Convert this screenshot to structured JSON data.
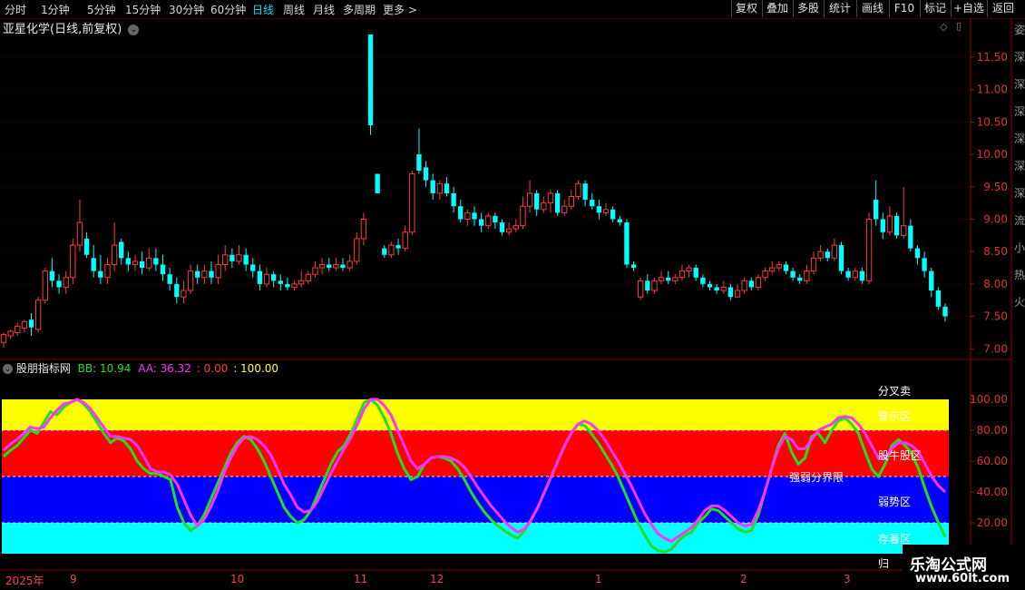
{
  "toolbar": {
    "periods": [
      "分时",
      "1分钟",
      "5分钟",
      "15分钟",
      "30分钟",
      "60分钟",
      "日线",
      "周线",
      "月线",
      "多周期",
      "更多 >"
    ],
    "active_period": "日线",
    "buttons": [
      "复权",
      "叠加",
      "多股",
      "统计",
      "画线",
      "F10",
      "标记",
      "+自选",
      "返回"
    ]
  },
  "main_panel": {
    "stock_title": "亚星化学(日线,前复权)",
    "price_ticks": [
      "11.50",
      "11.00",
      "10.50",
      "10.00",
      "9.50",
      "9.00",
      "8.50",
      "8.00",
      "7.50",
      "7.00"
    ],
    "price_range": [
      6.85,
      11.85
    ],
    "colors": {
      "up": "#ff3b3b",
      "down": "#00ffff"
    }
  },
  "indicator_panel": {
    "name": "股朋指标网",
    "bb_label": "BB: 10.94",
    "aa_label": "AA: 36.32",
    "zero_label": ": 0.00",
    "hundred_label": ": 100.00",
    "ticks": [
      "100.00",
      "80.00",
      "60.00",
      "40.00",
      "20.00"
    ],
    "zones": {
      "sell": "分叉卖",
      "alert": "警示区",
      "bull": "股牛股区",
      "divider": "强弱分界限",
      "weak": "弱势区",
      "store": "存着区",
      "bottom": "归"
    },
    "zone_colors": {
      "yellow": "#ffff00",
      "red": "#ff0000",
      "blue": "#0000ff",
      "cyan": "#00ffff"
    },
    "series_colors": {
      "BB": "#22dd22",
      "AA": "#ff33ff"
    }
  },
  "time_axis": [
    "2025年",
    "9",
    "10",
    "11",
    "12",
    "1",
    "2",
    "3"
  ],
  "watermark": {
    "brand": "乐淘公式网",
    "url": "www.60lt.com"
  },
  "right_strip": [
    "姿",
    "深",
    "深",
    "深",
    "深",
    "深",
    "深",
    "流",
    "小",
    "热",
    "火"
  ],
  "chart_data": {
    "type": "candlestick",
    "candles": [
      [
        7.1,
        7.22,
        7.25,
        7.02
      ],
      [
        7.2,
        7.27,
        7.3,
        7.15
      ],
      [
        7.25,
        7.35,
        7.4,
        7.2
      ],
      [
        7.32,
        7.42,
        7.45,
        7.25
      ],
      [
        7.45,
        7.33,
        7.55,
        7.2
      ],
      [
        7.3,
        7.75,
        7.8,
        7.25
      ],
      [
        7.75,
        8.2,
        8.25,
        7.7
      ],
      [
        8.2,
        8.05,
        8.4,
        7.95
      ],
      [
        8.05,
        7.95,
        8.15,
        7.85
      ],
      [
        7.95,
        8.1,
        8.2,
        7.85
      ],
      [
        8.1,
        8.6,
        8.7,
        8.0
      ],
      [
        8.6,
        8.95,
        9.3,
        8.5
      ],
      [
        8.7,
        8.45,
        8.8,
        8.4
      ],
      [
        8.4,
        8.2,
        8.6,
        8.1
      ],
      [
        8.2,
        8.1,
        8.45,
        8.0
      ],
      [
        8.1,
        8.3,
        8.4,
        8.0
      ],
      [
        8.3,
        8.6,
        8.95,
        8.2
      ],
      [
        8.65,
        8.4,
        8.7,
        8.3
      ],
      [
        8.4,
        8.3,
        8.5,
        8.2
      ],
      [
        8.3,
        8.35,
        8.45,
        8.2
      ],
      [
        8.35,
        8.25,
        8.5,
        8.15
      ],
      [
        8.25,
        8.4,
        8.55,
        8.2
      ],
      [
        8.4,
        8.3,
        8.55,
        8.2
      ],
      [
        8.3,
        8.15,
        8.45,
        8.05
      ],
      [
        8.15,
        8.0,
        8.25,
        7.9
      ],
      [
        8.0,
        7.8,
        8.1,
        7.7
      ],
      [
        7.8,
        7.9,
        8.05,
        7.7
      ],
      [
        7.9,
        8.2,
        8.3,
        7.85
      ],
      [
        8.2,
        8.1,
        8.3,
        8.0
      ],
      [
        8.1,
        8.2,
        8.3,
        8.0
      ],
      [
        8.2,
        8.1,
        8.35,
        8.0
      ],
      [
        8.1,
        8.3,
        8.45,
        8.0
      ],
      [
        8.3,
        8.45,
        8.6,
        8.2
      ],
      [
        8.45,
        8.35,
        8.55,
        8.25
      ],
      [
        8.35,
        8.45,
        8.6,
        8.3
      ],
      [
        8.45,
        8.3,
        8.55,
        8.2
      ],
      [
        8.3,
        8.2,
        8.4,
        8.1
      ],
      [
        8.2,
        8.0,
        8.3,
        7.9
      ],
      [
        8.0,
        8.15,
        8.25,
        7.95
      ],
      [
        8.15,
        8.05,
        8.2,
        7.95
      ],
      [
        8.05,
        8.0,
        8.15,
        7.9
      ],
      [
        8.0,
        7.95,
        8.1,
        7.9
      ],
      [
        7.95,
        8.0,
        8.05,
        7.9
      ],
      [
        8.0,
        8.05,
        8.2,
        7.95
      ],
      [
        8.05,
        8.15,
        8.2,
        8.0
      ],
      [
        8.15,
        8.25,
        8.35,
        8.1
      ],
      [
        8.25,
        8.3,
        8.4,
        8.15
      ],
      [
        8.3,
        8.25,
        8.4,
        8.2
      ],
      [
        8.25,
        8.3,
        8.4,
        8.2
      ],
      [
        8.3,
        8.25,
        8.4,
        8.2
      ],
      [
        8.25,
        8.35,
        8.45,
        8.2
      ],
      [
        8.35,
        8.7,
        8.8,
        8.3
      ],
      [
        8.7,
        9.0,
        9.1,
        8.6
      ],
      [
        11.85,
        10.45,
        11.85,
        10.3
      ],
      [
        9.7,
        9.4,
        9.7,
        9.4
      ],
      [
        8.55,
        8.45,
        8.6,
        8.4
      ],
      [
        8.45,
        8.6,
        8.65,
        8.4
      ],
      [
        8.6,
        8.55,
        8.7,
        8.45
      ],
      [
        8.55,
        8.8,
        8.9,
        8.5
      ],
      [
        8.8,
        9.7,
        9.75,
        8.75
      ],
      [
        10.0,
        9.75,
        10.4,
        9.7
      ],
      [
        9.8,
        9.6,
        9.9,
        9.5
      ],
      [
        9.6,
        9.4,
        9.7,
        9.3
      ],
      [
        9.4,
        9.55,
        9.6,
        9.3
      ],
      [
        9.55,
        9.4,
        9.65,
        9.35
      ],
      [
        9.4,
        9.2,
        9.5,
        9.1
      ],
      [
        9.2,
        9.0,
        9.3,
        8.95
      ],
      [
        9.0,
        9.1,
        9.15,
        8.9
      ],
      [
        9.1,
        9.0,
        9.2,
        8.9
      ],
      [
        9.0,
        8.9,
        9.1,
        8.8
      ],
      [
        8.9,
        9.05,
        9.1,
        8.85
      ],
      [
        9.05,
        8.95,
        9.1,
        8.85
      ],
      [
        8.95,
        8.8,
        9.0,
        8.75
      ],
      [
        8.8,
        8.85,
        8.95,
        8.75
      ],
      [
        8.85,
        8.9,
        9.0,
        8.8
      ],
      [
        8.9,
        9.2,
        9.35,
        8.85
      ],
      [
        9.2,
        9.4,
        9.6,
        9.1
      ],
      [
        9.4,
        9.15,
        9.45,
        9.05
      ],
      [
        9.15,
        9.25,
        9.35,
        9.1
      ],
      [
        9.25,
        9.4,
        9.45,
        9.1
      ],
      [
        9.4,
        9.1,
        9.45,
        9.05
      ],
      [
        9.1,
        9.2,
        9.3,
        9.05
      ],
      [
        9.2,
        9.35,
        9.45,
        9.15
      ],
      [
        9.35,
        9.55,
        9.6,
        9.3
      ],
      [
        9.55,
        9.3,
        9.6,
        9.2
      ],
      [
        9.3,
        9.2,
        9.4,
        9.15
      ],
      [
        9.2,
        9.1,
        9.3,
        9.0
      ],
      [
        9.1,
        9.15,
        9.25,
        9.05
      ],
      [
        9.15,
        9.0,
        9.2,
        8.95
      ],
      [
        9.0,
        8.95,
        9.05,
        8.9
      ],
      [
        8.95,
        8.3,
        9.0,
        8.25
      ],
      [
        8.3,
        8.25,
        8.35,
        8.2
      ],
      [
        7.8,
        8.05,
        8.1,
        7.75
      ],
      [
        8.05,
        7.9,
        8.15,
        7.85
      ],
      [
        7.9,
        8.05,
        8.1,
        7.85
      ],
      [
        8.05,
        8.1,
        8.2,
        8.0
      ],
      [
        8.1,
        8.05,
        8.2,
        8.0
      ],
      [
        8.05,
        8.1,
        8.15,
        8.0
      ],
      [
        8.1,
        8.2,
        8.3,
        8.05
      ],
      [
        8.2,
        8.25,
        8.3,
        8.1
      ],
      [
        8.25,
        8.1,
        8.3,
        8.05
      ],
      [
        8.1,
        8.0,
        8.15,
        7.95
      ],
      [
        8.0,
        7.95,
        8.05,
        7.9
      ],
      [
        7.95,
        7.9,
        8.0,
        7.85
      ],
      [
        7.9,
        7.95,
        8.05,
        7.85
      ],
      [
        7.95,
        7.8,
        8.0,
        7.75
      ],
      [
        7.8,
        7.9,
        8.0,
        7.8
      ],
      [
        7.9,
        8.05,
        8.1,
        7.85
      ],
      [
        8.05,
        7.95,
        8.1,
        7.9
      ],
      [
        7.95,
        8.1,
        8.15,
        7.9
      ],
      [
        8.1,
        8.2,
        8.25,
        8.05
      ],
      [
        8.2,
        8.25,
        8.35,
        8.15
      ],
      [
        8.25,
        8.3,
        8.35,
        8.2
      ],
      [
        8.3,
        8.2,
        8.35,
        8.15
      ],
      [
        8.2,
        8.1,
        8.25,
        8.05
      ],
      [
        8.1,
        8.05,
        8.15,
        8.0
      ],
      [
        8.05,
        8.2,
        8.3,
        8.0
      ],
      [
        8.2,
        8.4,
        8.5,
        8.15
      ],
      [
        8.4,
        8.5,
        8.6,
        8.35
      ],
      [
        8.5,
        8.4,
        8.55,
        8.35
      ],
      [
        8.4,
        8.6,
        8.7,
        8.35
      ],
      [
        8.6,
        8.2,
        8.65,
        8.15
      ],
      [
        8.2,
        8.1,
        8.25,
        8.05
      ],
      [
        8.1,
        8.2,
        8.25,
        8.05
      ],
      [
        8.2,
        8.05,
        8.25,
        8.0
      ],
      [
        8.05,
        9.0,
        9.1,
        8.0
      ],
      [
        9.3,
        9.0,
        9.6,
        8.9
      ],
      [
        9.0,
        8.8,
        9.1,
        8.7
      ],
      [
        8.8,
        9.05,
        9.2,
        8.75
      ],
      [
        9.05,
        8.75,
        9.1,
        8.7
      ],
      [
        8.75,
        8.9,
        9.5,
        8.7
      ],
      [
        8.9,
        8.55,
        9.0,
        8.5
      ],
      [
        8.55,
        8.4,
        8.6,
        8.3
      ],
      [
        8.4,
        8.2,
        8.5,
        8.1
      ],
      [
        8.2,
        7.9,
        8.25,
        7.8
      ],
      [
        7.9,
        7.65,
        7.95,
        7.6
      ],
      [
        7.65,
        7.5,
        7.7,
        7.42
      ]
    ],
    "BB": [
      63,
      67,
      70,
      75,
      80,
      78,
      85,
      92,
      90,
      95,
      98,
      100,
      97,
      92,
      85,
      78,
      72,
      75,
      73,
      68,
      60,
      55,
      52,
      52,
      50,
      48,
      30,
      20,
      15,
      18,
      25,
      35,
      45,
      55,
      65,
      72,
      76,
      74,
      68,
      60,
      50,
      40,
      30,
      24,
      20,
      22,
      28,
      38,
      48,
      58,
      66,
      70,
      78,
      88,
      98,
      100,
      96,
      88,
      78,
      65,
      55,
      48,
      50,
      58,
      62,
      63,
      62,
      60,
      55,
      48,
      40,
      33,
      27,
      22,
      18,
      15,
      12,
      10,
      15,
      22,
      30,
      40,
      50,
      60,
      70,
      78,
      84,
      83,
      78,
      72,
      65,
      58,
      50,
      40,
      30,
      20,
      12,
      5,
      2,
      1,
      3,
      8,
      12,
      14,
      20,
      24,
      29,
      28,
      24,
      20,
      16,
      14,
      15,
      25,
      40,
      55,
      70,
      78,
      66,
      58,
      62,
      76,
      78,
      72,
      80,
      86,
      88,
      84,
      78,
      66,
      55,
      50,
      58,
      70,
      74,
      70,
      65,
      55,
      42,
      30,
      20,
      11
    ],
    "AA": [
      67,
      71,
      74,
      78,
      82,
      81,
      82,
      88,
      93,
      97,
      98,
      100,
      98,
      94,
      88,
      82,
      76,
      76,
      75,
      74,
      70,
      63,
      55,
      53,
      53,
      51,
      45,
      35,
      25,
      18,
      22,
      30,
      40,
      52,
      62,
      70,
      75,
      76,
      74,
      70,
      64,
      55,
      45,
      38,
      30,
      27,
      28,
      34,
      43,
      52,
      60,
      68,
      75,
      84,
      94,
      100,
      100,
      96,
      90,
      80,
      70,
      60,
      55,
      58,
      62,
      63,
      63,
      62,
      60,
      56,
      50,
      43,
      37,
      31,
      26,
      21,
      17,
      14,
      16,
      22,
      30,
      40,
      50,
      60,
      70,
      78,
      84,
      86,
      84,
      80,
      74,
      67,
      60,
      52,
      44,
      35,
      26,
      19,
      13,
      10,
      8,
      11,
      14,
      17,
      22,
      28,
      31,
      31,
      28,
      24,
      20,
      18,
      19,
      28,
      40,
      55,
      68,
      76,
      74,
      68,
      68,
      74,
      80,
      82,
      84,
      88,
      89,
      88,
      84,
      78,
      70,
      62,
      62,
      68,
      72,
      72,
      70,
      66,
      58,
      50,
      44,
      40
    ]
  }
}
